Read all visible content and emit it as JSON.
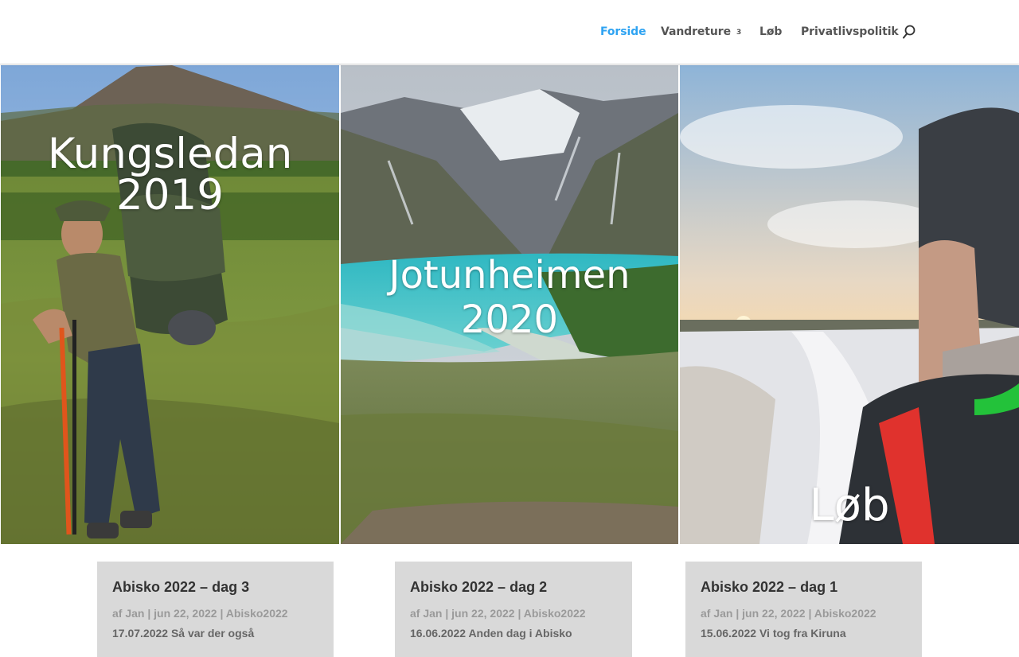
{
  "colors": {
    "accent": "#2ea3f2",
    "nav_text": "#555555",
    "post_bg": "#d9d9d9",
    "meta_text": "#9a9a9a"
  },
  "nav": {
    "items": [
      {
        "label": "Forside",
        "active": true
      },
      {
        "label": "Vandreture",
        "chevron": "3"
      },
      {
        "label": "Løb"
      },
      {
        "label": "Privatlivspolitik"
      }
    ],
    "search_icon": "search-icon"
  },
  "tiles": [
    {
      "title": "Kungsledan 2019"
    },
    {
      "title": "Jotunheimen 2020"
    },
    {
      "title": "Løb"
    }
  ],
  "posts": [
    {
      "title": "Abisko 2022 – dag 3",
      "meta": {
        "prefix": "af",
        "author": "Jan",
        "date": "jun 22, 2022",
        "category": "Abisko2022"
      },
      "excerpt": "17.07.2022 Så var der også"
    },
    {
      "title": "Abisko 2022 – dag 2",
      "meta": {
        "prefix": "af",
        "author": "Jan",
        "date": "jun 22, 2022",
        "category": "Abisko2022"
      },
      "excerpt": "16.06.2022 Anden dag i Abisko"
    },
    {
      "title": "Abisko 2022 – dag 1",
      "meta": {
        "prefix": "af",
        "author": "Jan",
        "date": "jun 22, 2022",
        "category": "Abisko2022"
      },
      "excerpt": "15.06.2022 Vi tog fra Kiruna"
    }
  ]
}
